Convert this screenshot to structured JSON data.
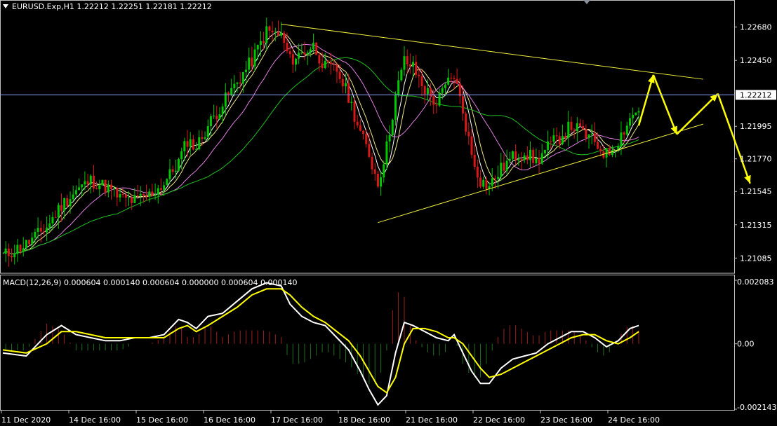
{
  "symbol_header": "EURUSD.Exp,H1  1.22212 1.22251 1.22181 1.22212",
  "macd_header": "MACD(12,26,9) 0.000604 0.000140 0.000604 0.000000 0.000604 0.000140",
  "current_price_label": "1.22212",
  "colors": {
    "background": "#000000",
    "bull_candle": "#00c800",
    "bear_candle": "#d81818",
    "ma_fast": "#ffffff",
    "ma_medium": "#f0e68c",
    "ma_slow": "#e080e0",
    "ma_long": "#20c020",
    "trendline": "#f0f040",
    "forecast_arrow": "#ffff00",
    "macd_line": "#ffffff",
    "signal_line": "#ffff00",
    "hist_positive": "#a02020",
    "hist_negative": "#1f6f1f",
    "price_line": "#8ca0ff"
  },
  "chart_data": [
    {
      "type": "candlestick",
      "title": "EURUSD.Exp,H1",
      "ohlc_last": {
        "open": 1.22212,
        "high": 1.22251,
        "low": 1.22181,
        "close": 1.22212
      },
      "current_price": 1.22212,
      "ylim": [
        1.2098,
        1.2278
      ],
      "y_ticks": [
        "1.22680",
        "1.22450",
        "1.22212",
        "1.21995",
        "1.21770",
        "1.21545",
        "1.21315",
        "1.21085"
      ],
      "x_ticks": [
        "11 Dec 2020",
        "14 Dec 16:00",
        "15 Dec 16:00",
        "16 Dec 16:00",
        "17 Dec 16:00",
        "18 Dec 16:00",
        "21 Dec 16:00",
        "22 Dec 16:00",
        "23 Dec 16:00",
        "24 Dec 16:00"
      ],
      "close_path": [
        [
          0,
          1.211
        ],
        [
          8,
          1.2118
        ],
        [
          15,
          1.213
        ],
        [
          20,
          1.2145
        ],
        [
          25,
          1.2155
        ],
        [
          30,
          1.2162
        ],
        [
          35,
          1.2158
        ],
        [
          40,
          1.215
        ],
        [
          45,
          1.2148
        ],
        [
          50,
          1.2152
        ],
        [
          55,
          1.216
        ],
        [
          60,
          1.2175
        ],
        [
          63,
          1.219
        ],
        [
          66,
          1.2185
        ],
        [
          70,
          1.22
        ],
        [
          75,
          1.2215
        ],
        [
          80,
          1.223
        ],
        [
          85,
          1.2245
        ],
        [
          90,
          1.2265
        ],
        [
          95,
          1.2262
        ],
        [
          98,
          1.2245
        ],
        [
          102,
          1.225
        ],
        [
          106,
          1.2255
        ],
        [
          110,
          1.224
        ],
        [
          114,
          1.2238
        ],
        [
          118,
          1.222
        ],
        [
          122,
          1.2195
        ],
        [
          125,
          1.218
        ],
        [
          128,
          1.216
        ],
        [
          131,
          1.2185
        ],
        [
          134,
          1.222
        ],
        [
          137,
          1.2245
        ],
        [
          140,
          1.224
        ],
        [
          144,
          1.2225
        ],
        [
          148,
          1.2215
        ],
        [
          152,
          1.223
        ],
        [
          154,
          1.2235
        ],
        [
          157,
          1.221
        ],
        [
          160,
          1.218
        ],
        [
          163,
          1.2162
        ],
        [
          166,
          1.2158
        ],
        [
          170,
          1.217
        ],
        [
          174,
          1.2178
        ],
        [
          178,
          1.2182
        ],
        [
          182,
          1.2175
        ],
        [
          186,
          1.2185
        ],
        [
          190,
          1.2192
        ],
        [
          194,
          1.22
        ],
        [
          198,
          1.2195
        ],
        [
          202,
          1.2188
        ],
        [
          206,
          1.218
        ],
        [
          210,
          1.219
        ],
        [
          214,
          1.2205
        ],
        [
          217,
          1.2212
        ]
      ],
      "moving_averages": [
        "ma_fast",
        "ma_medium",
        "ma_slow",
        "ma_long"
      ],
      "triangle": {
        "upper": [
          [
            95,
            1.227
          ],
          [
            239,
            1.2232
          ]
        ],
        "lower": [
          [
            128,
            1.2133
          ],
          [
            239,
            1.2201
          ]
        ]
      },
      "forecast": [
        [
          217,
          1.22
        ],
        [
          222,
          1.2235
        ],
        [
          230,
          1.2194
        ],
        [
          244,
          1.2222
        ],
        [
          255,
          1.216
        ]
      ]
    },
    {
      "type": "line",
      "title": "MACD(12,26,9)",
      "values_header": [
        0.000604,
        0.00014,
        0.000604,
        0.0,
        0.000604,
        0.00014
      ],
      "ylim": [
        -0.002143,
        0.002083
      ],
      "y_ticks": [
        "0.002083",
        "0.00",
        "-0.002143"
      ],
      "series": [
        {
          "name": "MACD",
          "points": [
            [
              0,
              -0.0003
            ],
            [
              8,
              -0.0004
            ],
            [
              15,
              0.0003
            ],
            [
              20,
              0.0006
            ],
            [
              25,
              0.0003
            ],
            [
              30,
              0.0002
            ],
            [
              35,
              0.0001
            ],
            [
              40,
              0.0001
            ],
            [
              45,
              0.0002
            ],
            [
              50,
              0.0002
            ],
            [
              55,
              0.0003
            ],
            [
              60,
              0.0008
            ],
            [
              63,
              0.0007
            ],
            [
              66,
              0.0005
            ],
            [
              70,
              0.0009
            ],
            [
              75,
              0.001
            ],
            [
              80,
              0.0014
            ],
            [
              85,
              0.0018
            ],
            [
              90,
              0.002
            ],
            [
              95,
              0.0019
            ],
            [
              98,
              0.0013
            ],
            [
              102,
              0.0009
            ],
            [
              106,
              0.0007
            ],
            [
              110,
              0.0006
            ],
            [
              114,
              0.0002
            ],
            [
              118,
              -0.0002
            ],
            [
              122,
              -0.0009
            ],
            [
              125,
              -0.0015
            ],
            [
              128,
              -0.002
            ],
            [
              131,
              -0.0017
            ],
            [
              134,
              -0.0003
            ],
            [
              137,
              0.0007
            ],
            [
              140,
              0.0006
            ],
            [
              144,
              0.0004
            ],
            [
              148,
              0.0002
            ],
            [
              152,
              0.0001
            ],
            [
              154,
              0.0003
            ],
            [
              157,
              -0.0003
            ],
            [
              160,
              -0.0009
            ],
            [
              163,
              -0.0013
            ],
            [
              166,
              -0.0013
            ],
            [
              170,
              -0.0008
            ],
            [
              174,
              -0.0005
            ],
            [
              178,
              -0.0004
            ],
            [
              182,
              -0.0003
            ],
            [
              186,
              0.0
            ],
            [
              190,
              0.0002
            ],
            [
              194,
              0.0004
            ],
            [
              198,
              0.0004
            ],
            [
              202,
              0.0002
            ],
            [
              206,
              -0.0001
            ],
            [
              210,
              0.0001
            ],
            [
              214,
              0.0005
            ],
            [
              217,
              0.0006
            ]
          ]
        },
        {
          "name": "Signal",
          "points": [
            [
              0,
              -0.0002
            ],
            [
              8,
              -0.0003
            ],
            [
              15,
              0.0
            ],
            [
              20,
              0.0004
            ],
            [
              25,
              0.0004
            ],
            [
              30,
              0.0003
            ],
            [
              35,
              0.0002
            ],
            [
              40,
              0.0002
            ],
            [
              45,
              0.0002
            ],
            [
              50,
              0.0002
            ],
            [
              55,
              0.0002
            ],
            [
              60,
              0.0005
            ],
            [
              63,
              0.0006
            ],
            [
              66,
              0.0004
            ],
            [
              70,
              0.0006
            ],
            [
              75,
              0.0009
            ],
            [
              80,
              0.0012
            ],
            [
              85,
              0.0016
            ],
            [
              90,
              0.0018
            ],
            [
              95,
              0.0018
            ],
            [
              98,
              0.0016
            ],
            [
              102,
              0.0012
            ],
            [
              106,
              0.0009
            ],
            [
              110,
              0.0007
            ],
            [
              114,
              0.0004
            ],
            [
              118,
              0.0001
            ],
            [
              122,
              -0.0004
            ],
            [
              125,
              -0.0009
            ],
            [
              128,
              -0.0014
            ],
            [
              131,
              -0.0016
            ],
            [
              134,
              -0.0011
            ],
            [
              137,
              0.0
            ],
            [
              140,
              0.0005
            ],
            [
              144,
              0.0005
            ],
            [
              148,
              0.0004
            ],
            [
              152,
              0.0002
            ],
            [
              154,
              0.0002
            ],
            [
              157,
              0.0
            ],
            [
              160,
              -0.0004
            ],
            [
              163,
              -0.0008
            ],
            [
              166,
              -0.0011
            ],
            [
              170,
              -0.001
            ],
            [
              174,
              -0.0008
            ],
            [
              178,
              -0.0006
            ],
            [
              182,
              -0.0004
            ],
            [
              186,
              -0.0002
            ],
            [
              190,
              0.0
            ],
            [
              194,
              0.0002
            ],
            [
              198,
              0.0003
            ],
            [
              202,
              0.0003
            ],
            [
              206,
              0.0001
            ],
            [
              210,
              0.0
            ],
            [
              214,
              0.0002
            ],
            [
              217,
              0.0004
            ]
          ]
        }
      ],
      "histogram": "difference between MACD and Signal"
    }
  ]
}
